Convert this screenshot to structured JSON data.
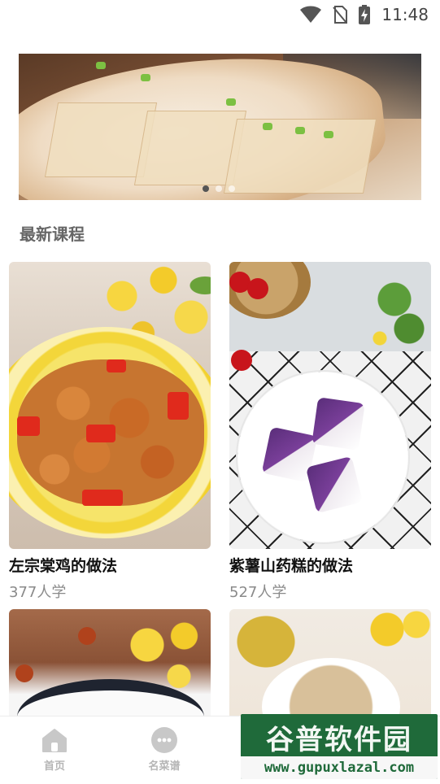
{
  "status_bar": {
    "time": "11:48"
  },
  "banner": {
    "dots": 3,
    "active_dot": 0
  },
  "section": {
    "title": "最新课程"
  },
  "courses": [
    {
      "title": "左宗棠鸡的做法",
      "count": "377人学"
    },
    {
      "title": "紫薯山药糕的做法",
      "count": "527人学"
    },
    {
      "title": "",
      "count": ""
    },
    {
      "title": "",
      "count": ""
    }
  ],
  "nav": {
    "items": [
      {
        "label": "首页",
        "icon": "home-icon"
      },
      {
        "label": "名菜谱",
        "icon": "chat-icon"
      }
    ]
  },
  "watermark": {
    "brand": "谷普软件园",
    "url": "www.gupuxlazal.com"
  }
}
